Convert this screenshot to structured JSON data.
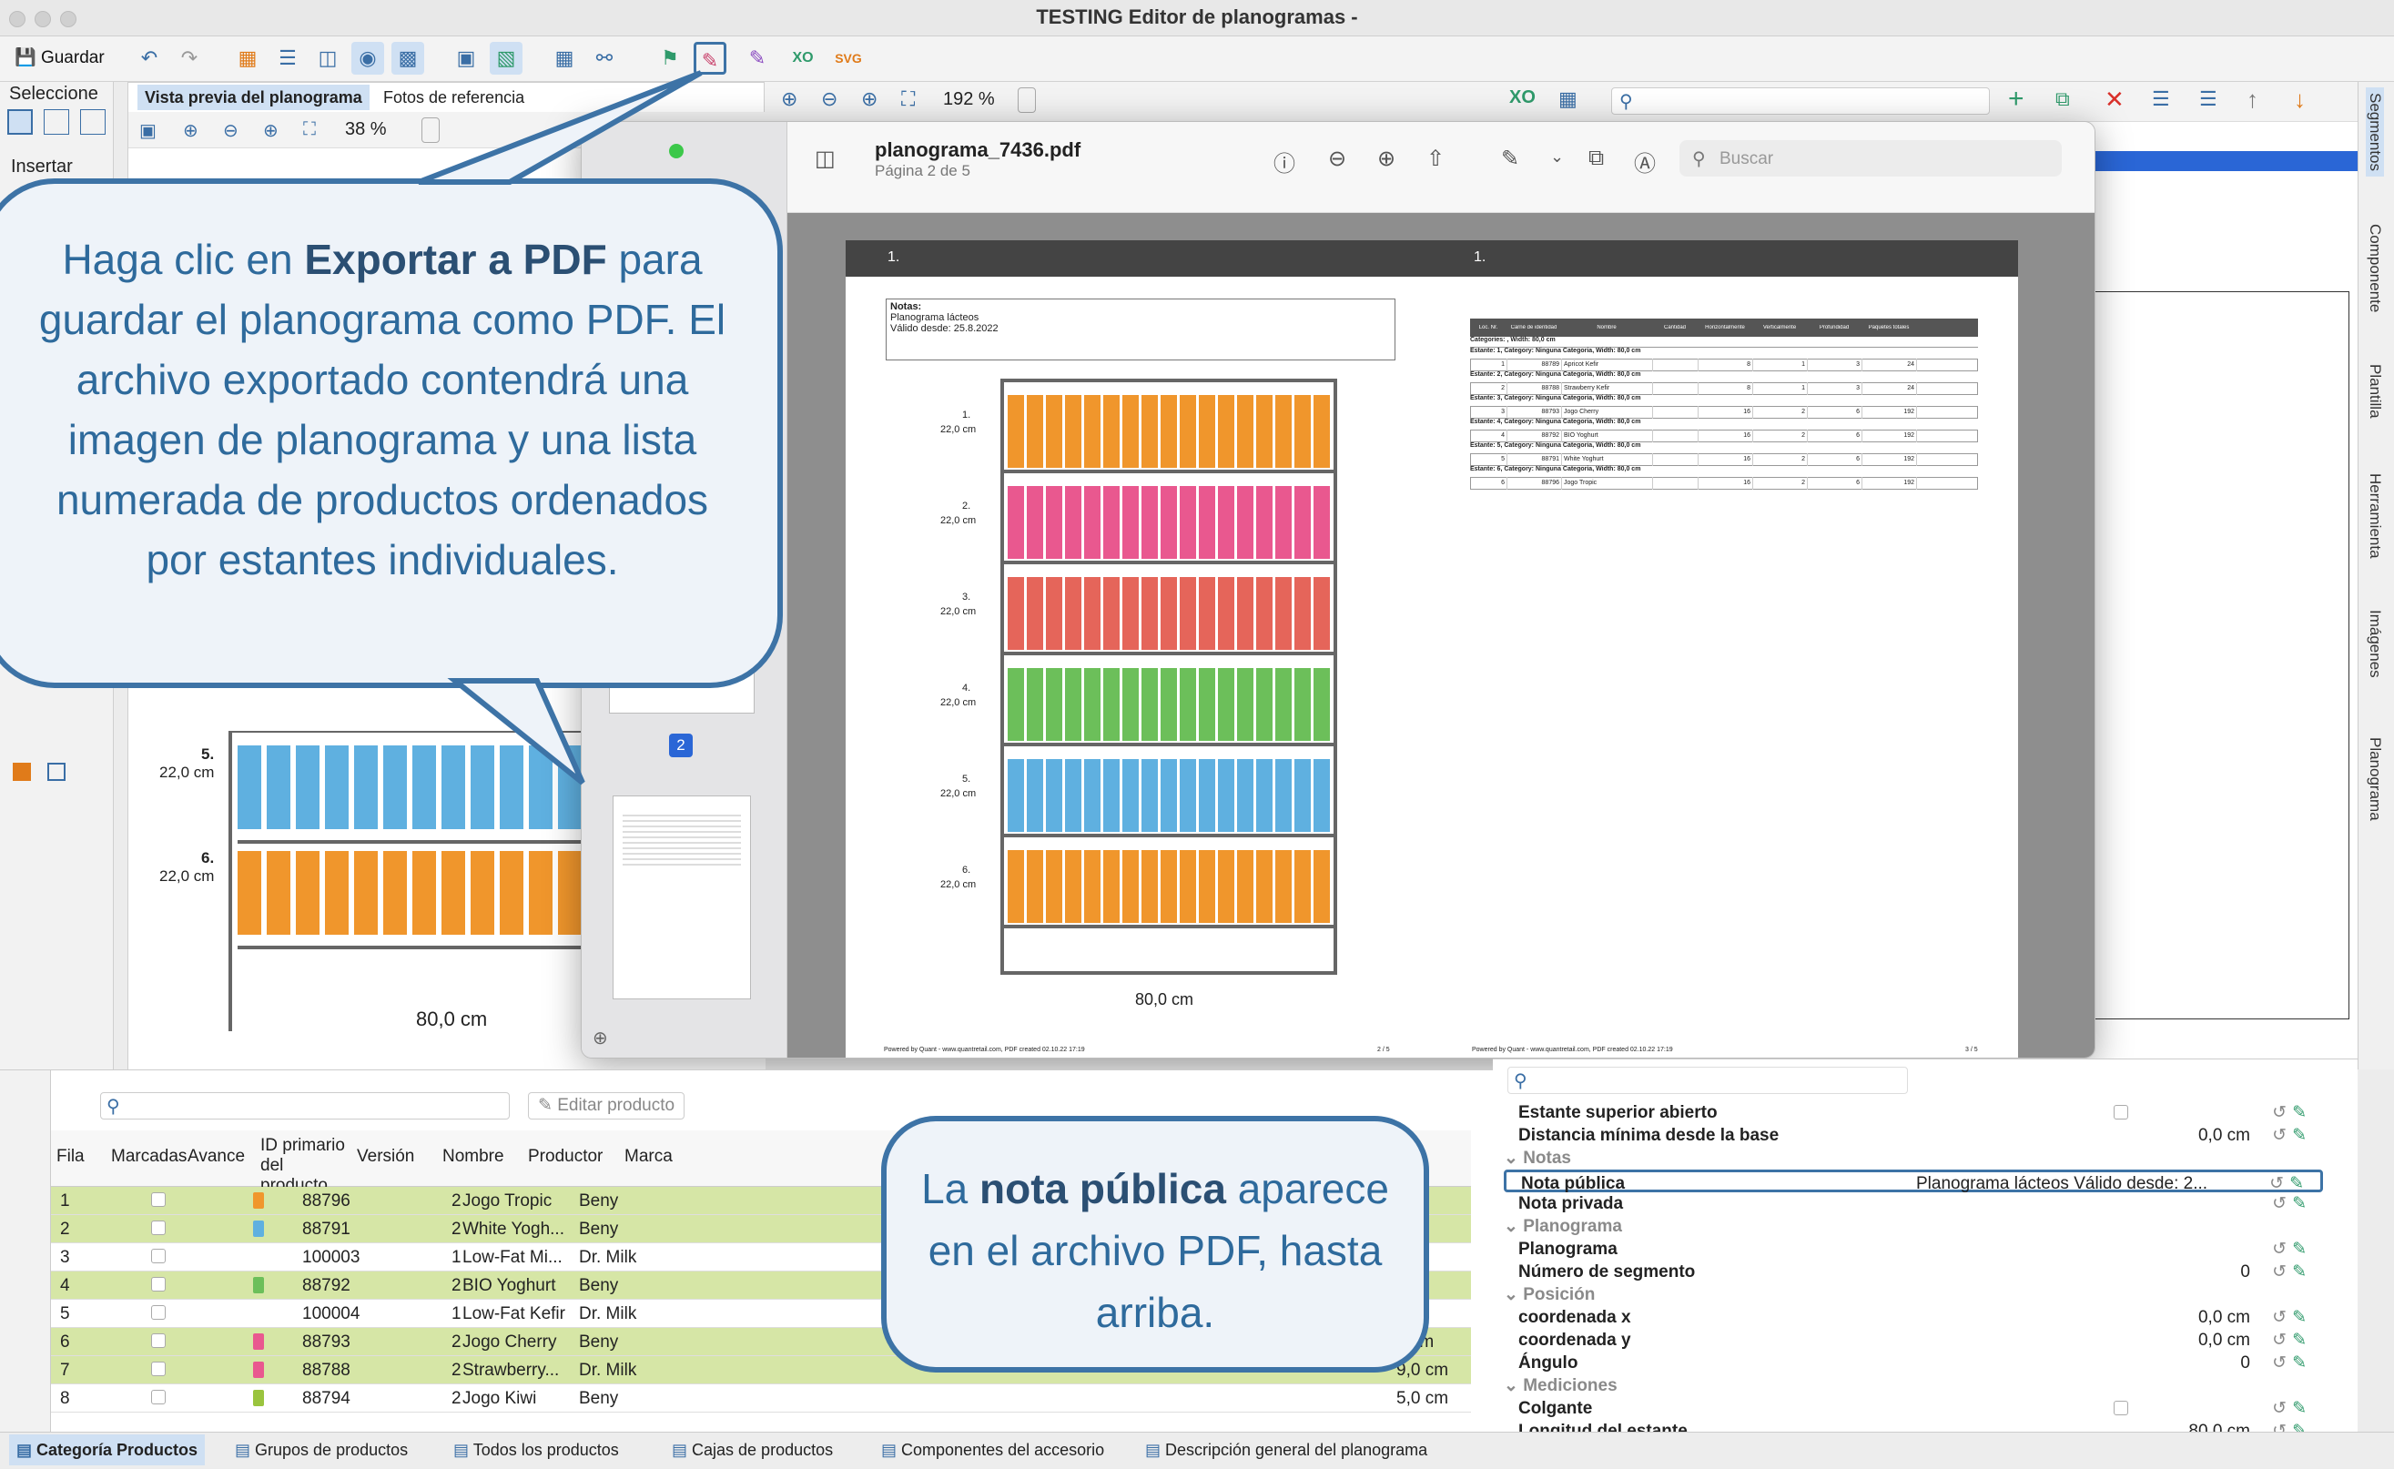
{
  "window": {
    "title": "TESTING Editor de planogramas -"
  },
  "toolbar": {
    "save_label": "Guardar"
  },
  "left": {
    "select_label": "Seleccione",
    "insert_label": "Insertar",
    "tab_preview": "Vista previa del planograma",
    "tab_photos": "Fotos de referencia",
    "zoom": "38 %",
    "shelf5_num": "5.",
    "shelf5_h": "22,0 cm",
    "shelf6_num": "6.",
    "shelf6_h": "22,0 cm",
    "width_label": "80,0 cm"
  },
  "middle": {
    "zoom": "192 %"
  },
  "pdf": {
    "filename": "planograma_7436.pdf",
    "page_info": "Página 2 de 5",
    "search_placeholder": "Buscar",
    "thumb_page": "2",
    "header_left": "1.",
    "header_right": "1.",
    "notes_label": "Notas:",
    "notes_line1": "Planograma lácteos",
    "notes_line2": "Válido desde: 25.8.2022",
    "shelves": [
      {
        "num": "1.",
        "h": "22,0 cm"
      },
      {
        "num": "2.",
        "h": "22,0 cm"
      },
      {
        "num": "3.",
        "h": "22,0 cm"
      },
      {
        "num": "4.",
        "h": "22,0 cm"
      },
      {
        "num": "5.",
        "h": "22,0 cm"
      },
      {
        "num": "6.",
        "h": "22,0 cm"
      }
    ],
    "width": "80,0 cm",
    "table_headers": [
      "Loc. Nr.",
      "Carné de identidad",
      "Nombre",
      "Cantidad",
      "Horizontalmente",
      "Verticalmente",
      "Profundidad",
      "Paquetes totales"
    ],
    "table_group0": "Categories: , Width: 80,0 cm",
    "table_groups": [
      "Estante: 1, Category: Ninguna Categoria, Width: 80,0 cm",
      "Estante: 2, Category: Ninguna Categoria, Width: 80,0 cm",
      "Estante: 3, Category: Ninguna Categoria, Width: 80,0 cm",
      "Estante: 4, Category: Ninguna Categoria, Width: 80,0 cm",
      "Estante: 5, Category: Ninguna Categoria, Width: 80,0 cm",
      "Estante: 6, Category: Ninguna Categoria, Width: 80,0 cm"
    ],
    "table_rows": [
      [
        "1",
        "88789",
        "Apricot Kefir",
        "",
        "8",
        "1",
        "3",
        "24"
      ],
      [
        "2",
        "88788",
        "Strawberry Kefir",
        "",
        "8",
        "1",
        "3",
        "24"
      ],
      [
        "3",
        "88793",
        "Jogo Cherry",
        "",
        "16",
        "2",
        "6",
        "192"
      ],
      [
        "4",
        "88792",
        "BIO Yoghurt",
        "",
        "16",
        "2",
        "6",
        "192"
      ],
      [
        "5",
        "88791",
        "White Yoghurt",
        "",
        "16",
        "2",
        "6",
        "192"
      ],
      [
        "6",
        "88796",
        "Jogo Tropic",
        "",
        "16",
        "2",
        "6",
        "192"
      ]
    ],
    "footer_left": "Powered by Quant - www.quantretail.com, PDF created 02.10.22 17:19",
    "footer_left_page": "2 / 5",
    "footer_right": "Powered by Quant - www.quantretail.com, PDF created 02.10.22 17:19",
    "footer_right_page": "3 / 5"
  },
  "callout1": {
    "pre": "Haga clic en ",
    "bold": "Exportar a PDF",
    "post": " para guardar el planograma como PDF. El archivo exportado contendrá una imagen de planograma y una lista numerada de productos ordenados por estantes individuales."
  },
  "callout2": {
    "pre": "La ",
    "bold": "nota pública",
    "post": " aparece en el archivo PDF, hasta arriba."
  },
  "bottom": {
    "edit_product": "Editar producto",
    "headers": [
      "Fila",
      "Marcadas",
      "Avance",
      "ID primario del producto",
      "Versión",
      "Nombre",
      "Productor",
      "Marca"
    ],
    "rows": [
      {
        "fila": "1",
        "id": "88796",
        "ver": "2",
        "name": "Jogo Tropic",
        "prod": "Beny",
        "right": ""
      },
      {
        "fila": "2",
        "id": "88791",
        "ver": "2",
        "name": "White Yogh...",
        "prod": "Beny",
        "right": "cm"
      },
      {
        "fila": "3",
        "id": "100003",
        "ver": "1",
        "name": "Low-Fat Mi...",
        "prod": "Dr. Milk",
        "right": "cm"
      },
      {
        "fila": "4",
        "id": "88792",
        "ver": "2",
        "name": "BIO Yoghurt",
        "prod": "Beny",
        "right": "cm"
      },
      {
        "fila": "5",
        "id": "100004",
        "ver": "1",
        "name": "Low-Fat Kefir",
        "prod": "Dr. Milk",
        "right": "cm"
      },
      {
        "fila": "6",
        "id": "88793",
        "ver": "2",
        "name": "Jogo Cherry",
        "prod": "Beny",
        "right": "0 cm"
      },
      {
        "fila": "7",
        "id": "88788",
        "ver": "2",
        "name": "Strawberry...",
        "prod": "Dr. Milk",
        "right": "9,0 cm"
      },
      {
        "fila": "8",
        "id": "88794",
        "ver": "2",
        "name": "Jogo Kiwi",
        "prod": "Beny",
        "right": "5,0 cm"
      }
    ],
    "tabs": [
      "Categoría Productos",
      "Grupos de productos",
      "Todos los productos",
      "Cajas de productos",
      "Componentes del accesorio",
      "Descripción general del planograma"
    ]
  },
  "props": {
    "items": [
      {
        "type": "prop",
        "label": "Estante superior abierto",
        "value": "",
        "check": true
      },
      {
        "type": "prop",
        "label": "Distancia mínima desde la base",
        "value": "0,0 cm"
      },
      {
        "type": "hdr",
        "label": "Notas"
      },
      {
        "type": "prop",
        "label": "Nota pública",
        "value": "Planograma lácteos Válido desde: 2...",
        "highlight": true
      },
      {
        "type": "prop",
        "label": "Nota privada",
        "value": ""
      },
      {
        "type": "hdr",
        "label": "Planograma"
      },
      {
        "type": "prop",
        "label": "Planograma",
        "value": ""
      },
      {
        "type": "prop",
        "label": "Número de segmento",
        "value": "0"
      },
      {
        "type": "hdr",
        "label": "Posición"
      },
      {
        "type": "prop",
        "label": "coordenada x",
        "value": "0,0 cm"
      },
      {
        "type": "prop",
        "label": "coordenada y",
        "value": "0,0 cm"
      },
      {
        "type": "prop",
        "label": "Ángulo",
        "value": "0"
      },
      {
        "type": "hdr",
        "label": "Mediciones"
      },
      {
        "type": "prop",
        "label": "Colgante",
        "value": "",
        "check": true
      },
      {
        "type": "prop",
        "label": "Longitud del estante",
        "value": "80,0 cm"
      }
    ]
  },
  "side_tabs": [
    "Segmentos",
    "Componente",
    "Plantilla",
    "Herramienta",
    "Imágenes",
    "Planograma"
  ]
}
